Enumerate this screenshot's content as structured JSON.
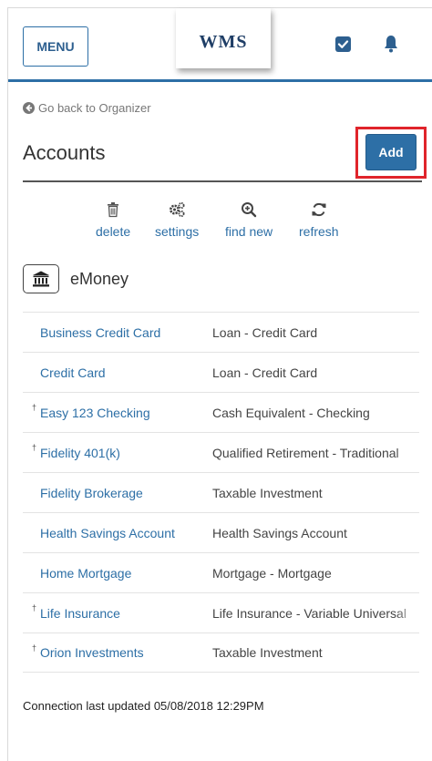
{
  "header": {
    "menu_label": "MENU",
    "logo_text": "WMS",
    "icons": [
      "check-square-icon",
      "bell-icon"
    ]
  },
  "back_link": {
    "label": "Go back to Organizer",
    "icon": "circle-arrow-left-icon"
  },
  "page_title": "Accounts",
  "add_label": "Add",
  "toolbar": [
    {
      "label": "delete",
      "icon": "trash-icon"
    },
    {
      "label": "settings",
      "icon": "gears-icon"
    },
    {
      "label": "find new",
      "icon": "zoom-in-icon"
    },
    {
      "label": "refresh",
      "icon": "refresh-icon"
    }
  ],
  "institution": {
    "name": "eMoney",
    "icon": "bank-icon"
  },
  "accounts": [
    {
      "dagger": "",
      "name": "Business Credit Card",
      "type": "Loan - Credit Card"
    },
    {
      "dagger": "",
      "name": "Credit Card",
      "type": "Loan - Credit Card"
    },
    {
      "dagger": "†",
      "name": "Easy 123 Checking",
      "type": "Cash Equivalent - Checking"
    },
    {
      "dagger": "†",
      "name": "Fidelity 401(k)",
      "type": "Qualified Retirement - Traditional"
    },
    {
      "dagger": "",
      "name": "Fidelity Brokerage",
      "type": "Taxable Investment"
    },
    {
      "dagger": "",
      "name": "Health Savings Account",
      "type": "Health Savings Account"
    },
    {
      "dagger": "",
      "name": "Home Mortgage",
      "type": "Mortgage - Mortgage"
    },
    {
      "dagger": "†",
      "name": "Life Insurance",
      "type": "Life Insurance - Variable Universal"
    },
    {
      "dagger": "†",
      "name": "Orion Investments",
      "type": "Taxable Investment"
    }
  ],
  "footer": "Connection last updated 05/08/2018 12:29PM",
  "colors": {
    "brand_blue": "#2d6fa6",
    "highlight_red": "#e0242b",
    "navy": "#1f3e66"
  }
}
